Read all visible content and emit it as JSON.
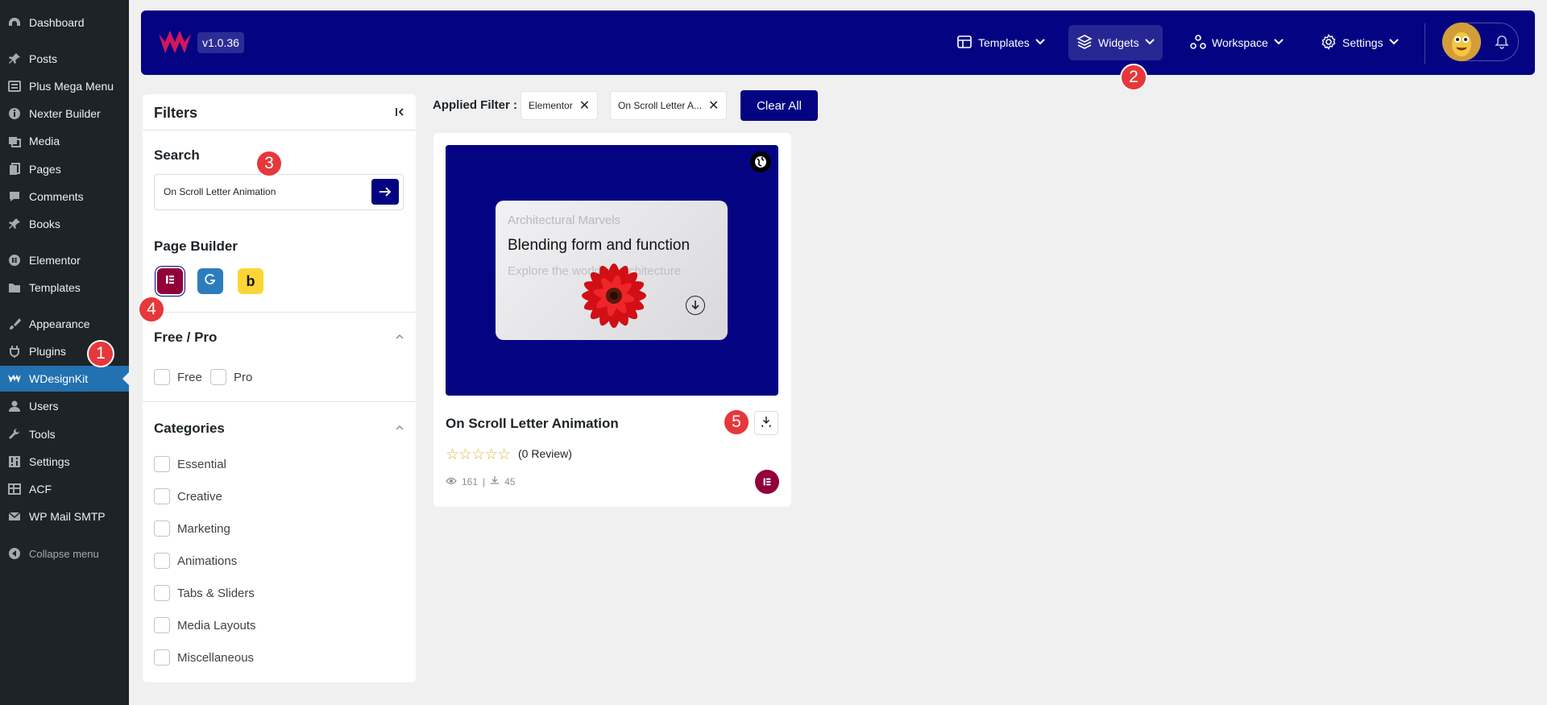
{
  "sidebar": {
    "items": [
      {
        "label": "Dashboard",
        "icon": "dashboard-icon"
      },
      {
        "label": "Posts",
        "icon": "pin-icon"
      },
      {
        "label": "Plus Mega Menu",
        "icon": "menu-icon"
      },
      {
        "label": "Nexter Builder",
        "icon": "info-icon"
      },
      {
        "label": "Media",
        "icon": "media-icon"
      },
      {
        "label": "Pages",
        "icon": "pages-icon"
      },
      {
        "label": "Comments",
        "icon": "comment-icon"
      },
      {
        "label": "Books",
        "icon": "pin-icon"
      },
      {
        "label": "Elementor",
        "icon": "elementor-icon"
      },
      {
        "label": "Templates",
        "icon": "folder-icon"
      },
      {
        "label": "Appearance",
        "icon": "brush-icon"
      },
      {
        "label": "Plugins",
        "icon": "plug-icon"
      },
      {
        "label": "WDesignKit",
        "icon": "wdesignkit-icon"
      },
      {
        "label": "Users",
        "icon": "user-icon"
      },
      {
        "label": "Tools",
        "icon": "wrench-icon"
      },
      {
        "label": "Settings",
        "icon": "settings-icon"
      },
      {
        "label": "ACF",
        "icon": "acf-icon"
      },
      {
        "label": "WP Mail SMTP",
        "icon": "mail-icon"
      }
    ],
    "collapse_label": "Collapse menu"
  },
  "topbar": {
    "version": "v1.0.36",
    "nav": [
      {
        "label": "Templates",
        "icon": "templates-icon"
      },
      {
        "label": "Widgets",
        "icon": "layers-icon"
      },
      {
        "label": "Workspace",
        "icon": "workspace-icon"
      },
      {
        "label": "Settings",
        "icon": "gear-icon"
      }
    ]
  },
  "filters": {
    "title": "Filters",
    "search_title": "Search",
    "search_value": "On Scroll Letter Animation",
    "page_builder_title": "Page Builder",
    "builders": [
      "Elementor",
      "Gutenberg",
      "Bricks"
    ],
    "free_pro_title": "Free / Pro",
    "free_pro_options": [
      "Free",
      "Pro"
    ],
    "categories_title": "Categories",
    "categories": [
      "Essential",
      "Creative",
      "Marketing",
      "Animations",
      "Tabs & Sliders",
      "Media Layouts",
      "Miscellaneous"
    ]
  },
  "applied": {
    "label": "Applied Filter :",
    "chips": [
      "Elementor",
      "On Scroll Letter A..."
    ],
    "clear_all": "Clear All"
  },
  "card": {
    "preview_eyebrow": "Architectural Marvels",
    "preview_headline": "Blending form and function",
    "preview_sub": "Explore the world of architecture",
    "title": "On Scroll Letter Animation",
    "rating": 0,
    "review_text": "(0 Review)",
    "views": "161",
    "downloads": "45"
  },
  "markers": [
    "1",
    "2",
    "3",
    "4",
    "5"
  ],
  "colors": {
    "brand_navy": "#040483",
    "wp_sidebar": "#1d2327",
    "wp_active": "#2271b1",
    "marker_red": "#e6383a",
    "elementor": "#92003b",
    "gutenberg": "#2c7dbe",
    "bricks": "#fcd535"
  }
}
